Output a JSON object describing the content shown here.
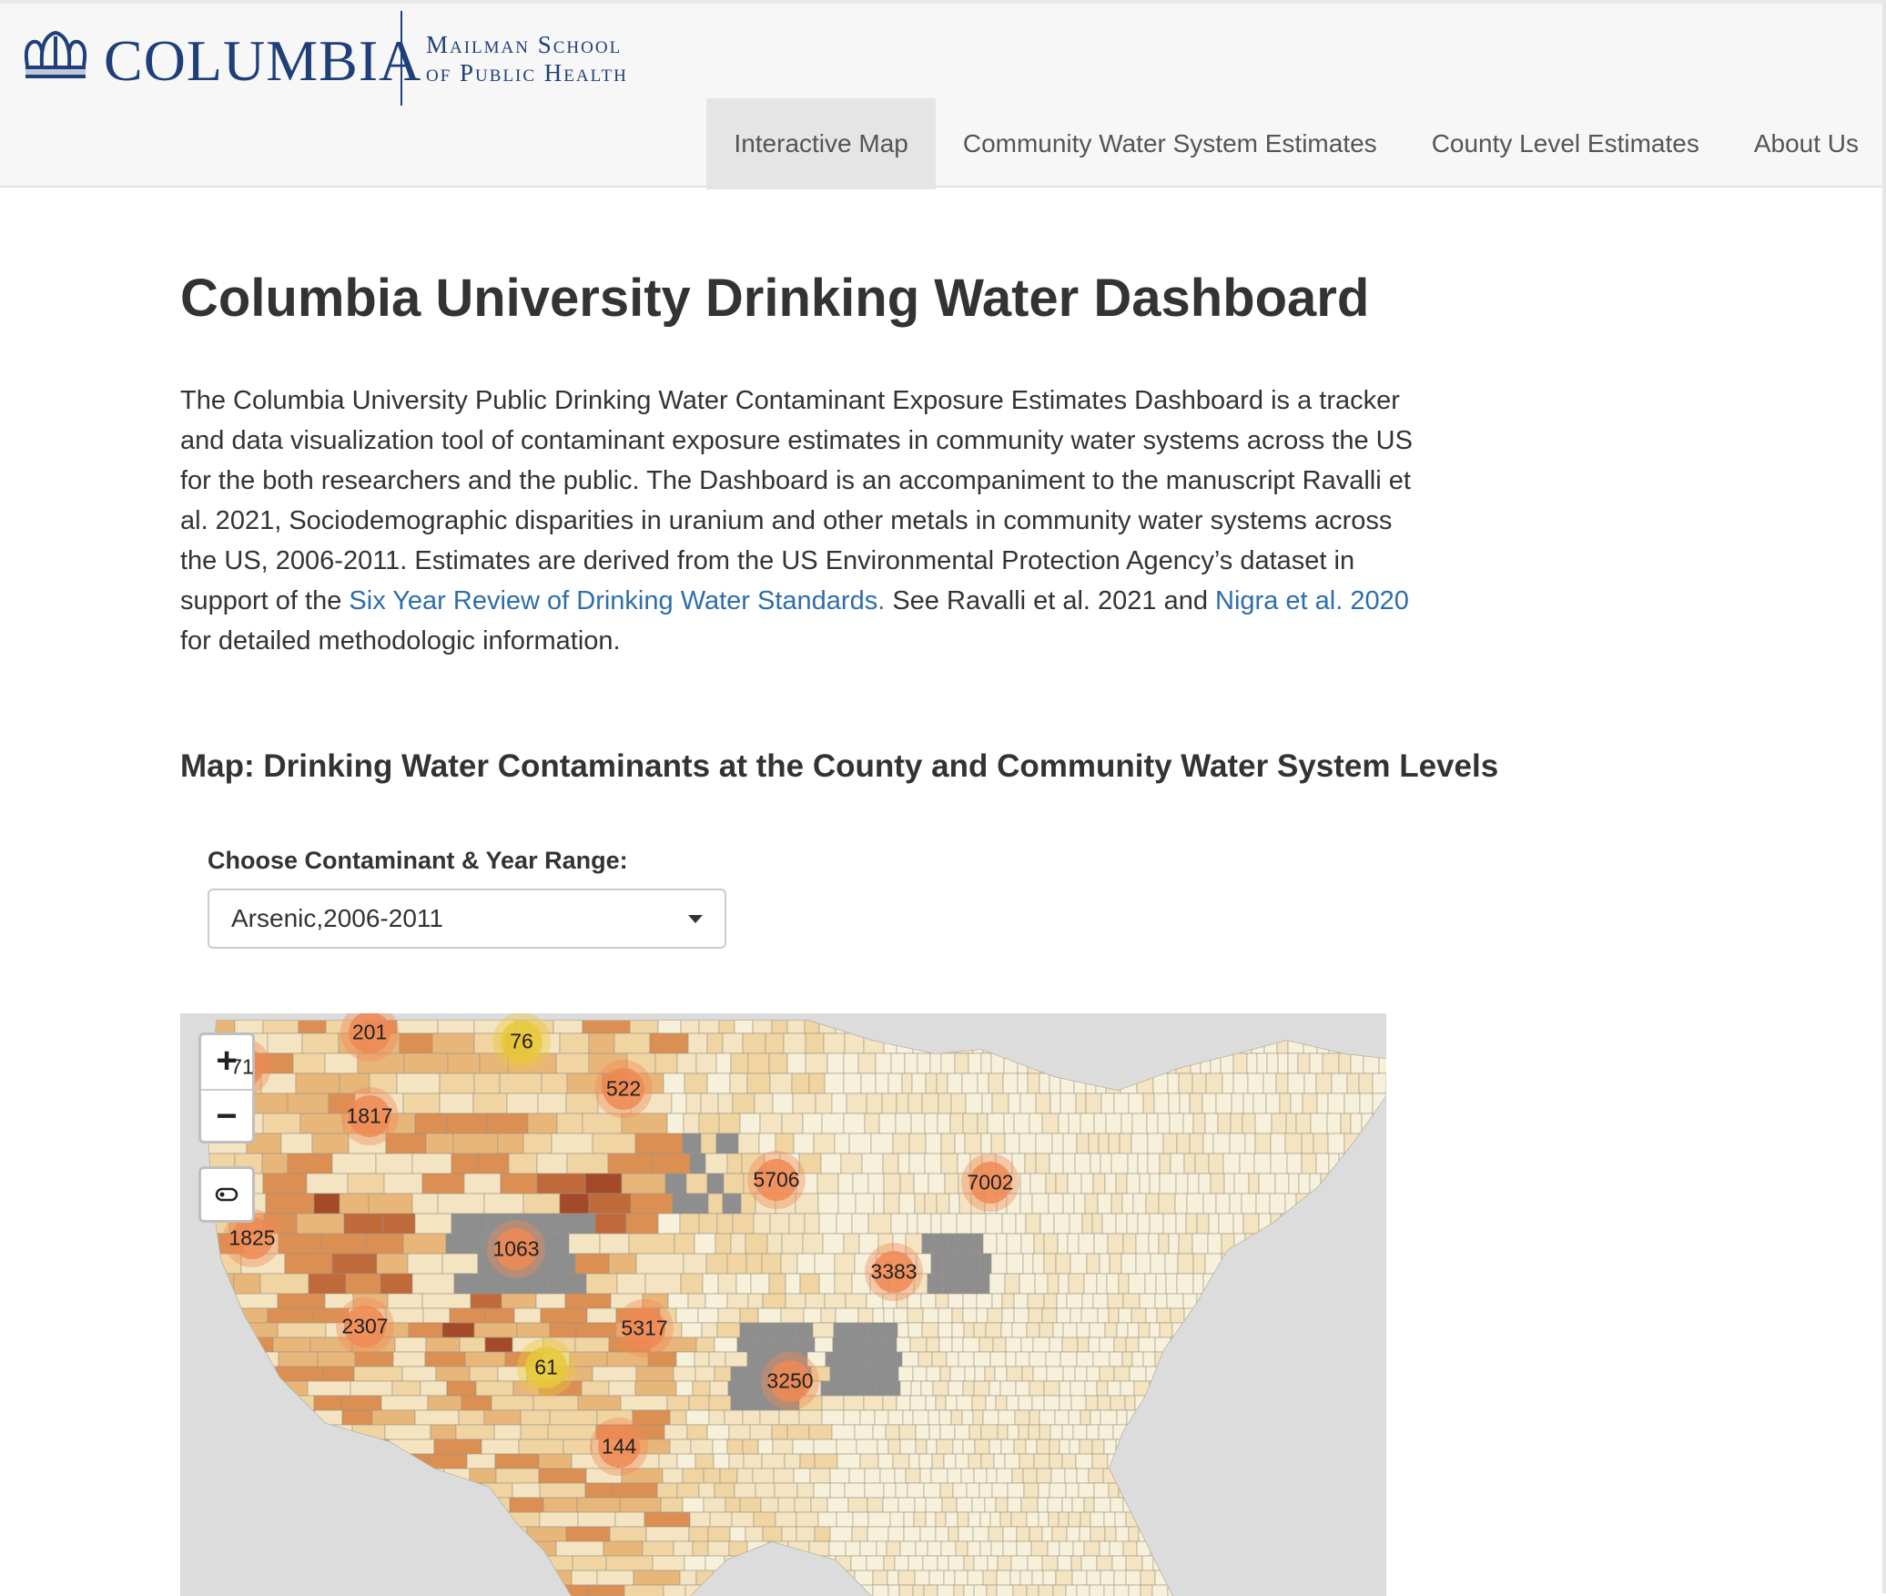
{
  "header": {
    "logo_word": "COLUMBIA",
    "school_line1": "Mailman School",
    "school_line2": "of Public Health",
    "brand_color": "#1f3f7a"
  },
  "nav": {
    "items": [
      {
        "label": "Interactive Map",
        "active": true
      },
      {
        "label": "Community Water System Estimates",
        "active": false
      },
      {
        "label": "County Level Estimates",
        "active": false
      },
      {
        "label": "About Us",
        "active": false
      }
    ]
  },
  "page": {
    "title": "Columbia University Drinking Water Dashboard",
    "intro_part1": "The Columbia University Public Drinking Water Contaminant Exposure Estimates Dashboard is a tracker and data visualization tool of contaminant exposure estimates in community water systems across the US for the both researchers and the public. The Dashboard is an accompaniment to the manuscript Ravalli et al. 2021, Sociodemographic disparities in uranium and other metals in community water systems across the US, 2006-2011. Estimates are derived from the US Environmental Protection Agency’s dataset in support of the ",
    "intro_link1": "Six Year Review of Drinking Water Standards.",
    "intro_part2": " See Ravalli et al. 2021 and ",
    "intro_link2": "Nigra et al. 2020",
    "intro_part3": " for detailed methodologic information.",
    "link_color": "#2f6ea8",
    "map_heading": "Map: Drinking Water Contaminants at the County and Community Water System Levels"
  },
  "selector": {
    "label": "Choose Contaminant & Year Range:",
    "value": "Arsenic,2006-2011"
  },
  "map": {
    "zoom_in": "+",
    "zoom_out": "−",
    "layers_icon": "layers-icon",
    "clusters": [
      {
        "label": "201",
        "color": "orange"
      },
      {
        "label": "71",
        "color": "orange"
      },
      {
        "label": "76",
        "color": "yellow"
      },
      {
        "label": "522",
        "color": "orange"
      },
      {
        "label": "1817",
        "color": "orange"
      },
      {
        "label": "5706",
        "color": "orange"
      },
      {
        "label": "7002",
        "color": "orange"
      },
      {
        "label": "1825",
        "color": "orange"
      },
      {
        "label": "1063",
        "color": "orange"
      },
      {
        "label": "3383",
        "color": "orange"
      },
      {
        "label": "2307",
        "color": "orange"
      },
      {
        "label": "5317",
        "color": "orange"
      },
      {
        "label": "61",
        "color": "yellow"
      },
      {
        "label": "3250",
        "color": "orange"
      },
      {
        "label": "144",
        "color": "orange"
      }
    ],
    "colors": {
      "background": "#dcdcdc",
      "no_data": "#8e8e8e",
      "cluster_orange": "#ef8a55",
      "cluster_yellow": "#e8c93a"
    }
  }
}
